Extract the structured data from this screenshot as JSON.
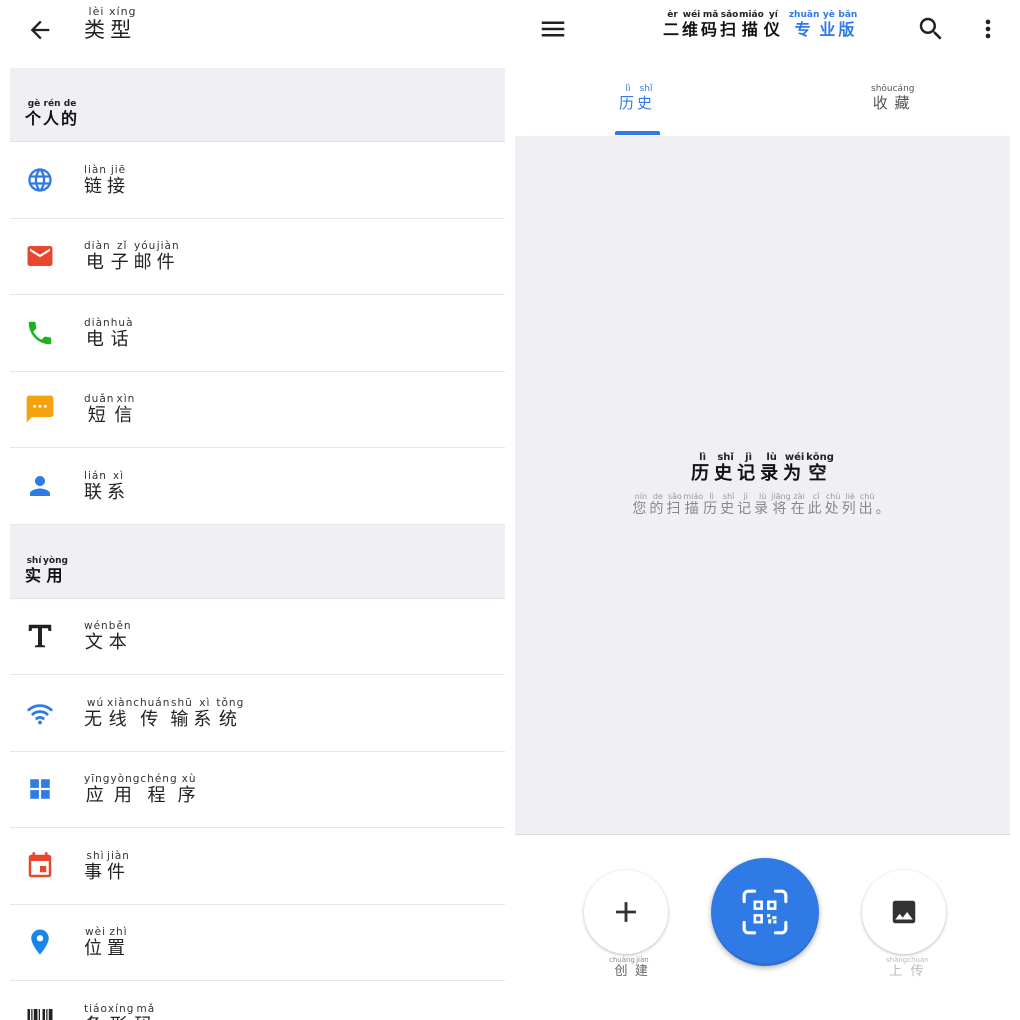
{
  "left": {
    "title": {
      "chars": [
        [
          "类",
          "lèi"
        ],
        [
          "型",
          "xíng"
        ]
      ]
    },
    "sections": [
      {
        "title": [
          [
            "个",
            "gè"
          ],
          [
            "人",
            "rén"
          ],
          [
            "的",
            "de"
          ]
        ],
        "items": [
          {
            "icon": "globe-icon",
            "label": [
              [
                "链",
                "liàn"
              ],
              [
                "接",
                "jiē"
              ]
            ]
          },
          {
            "icon": "email-icon",
            "label": [
              [
                "电",
                "diàn"
              ],
              [
                "子",
                "zǐ"
              ],
              [
                "邮",
                "yóu"
              ],
              [
                "件",
                "jiàn"
              ]
            ]
          },
          {
            "icon": "phone-icon",
            "label": [
              [
                "电",
                "diàn"
              ],
              [
                "话",
                "huà"
              ]
            ]
          },
          {
            "icon": "sms-icon",
            "label": [
              [
                "短",
                "duǎn"
              ],
              [
                "信",
                "xìn"
              ]
            ]
          },
          {
            "icon": "contact-icon",
            "label": [
              [
                "联",
                "lián"
              ],
              [
                "系",
                "xì"
              ]
            ]
          }
        ]
      },
      {
        "title": [
          [
            "实",
            "shí"
          ],
          [
            "用",
            "yòng"
          ]
        ],
        "items": [
          {
            "icon": "text-icon",
            "label": [
              [
                "文",
                "wén"
              ],
              [
                "本",
                "běn"
              ]
            ]
          },
          {
            "icon": "wifi-icon",
            "label": [
              [
                "无",
                "wú"
              ],
              [
                "线",
                "xiàn"
              ],
              [
                "传",
                "chuán"
              ],
              [
                "输",
                "shū"
              ],
              [
                "系",
                "xì"
              ],
              [
                "统",
                "tǒng"
              ]
            ]
          },
          {
            "icon": "apps-icon",
            "label": [
              [
                "应",
                "yīng"
              ],
              [
                "用",
                "yòng"
              ],
              [
                "程",
                "chéng"
              ],
              [
                "序",
                "xù"
              ]
            ]
          },
          {
            "icon": "calendar-icon",
            "label": [
              [
                "事",
                "shì"
              ],
              [
                "件",
                "jiàn"
              ]
            ]
          },
          {
            "icon": "location-icon",
            "label": [
              [
                "位",
                "wèi"
              ],
              [
                "置",
                "zhì"
              ]
            ]
          },
          {
            "icon": "barcode-icon",
            "label": [
              [
                "条",
                "tiáo"
              ],
              [
                "形",
                "xíng"
              ],
              [
                "码",
                "mǎ"
              ]
            ]
          }
        ]
      }
    ]
  },
  "right": {
    "title": [
      [
        "二",
        "èr"
      ],
      [
        "维",
        "wéi"
      ],
      [
        "码",
        "mǎ"
      ],
      [
        "扫",
        "sǎo"
      ],
      [
        "描",
        "miáo"
      ],
      [
        "仪",
        "yí"
      ]
    ],
    "title_pro": [
      [
        "专",
        "zhuān"
      ],
      [
        "业",
        "yè"
      ],
      [
        "版",
        "bǎn"
      ]
    ],
    "tabs": {
      "history": [
        [
          "历",
          "lì"
        ],
        [
          "史",
          "shǐ"
        ]
      ],
      "favorites": [
        [
          "收",
          "shōu"
        ],
        [
          "藏",
          "cáng"
        ]
      ]
    },
    "empty": {
      "title": [
        [
          "历",
          "lì"
        ],
        [
          "史",
          "shǐ"
        ],
        [
          "记",
          "jì"
        ],
        [
          "录",
          "lù"
        ],
        [
          "为",
          "wéi"
        ],
        [
          "空",
          "kōng"
        ]
      ],
      "subtitle": [
        [
          "您",
          "nín"
        ],
        [
          "的",
          "de"
        ],
        [
          "扫",
          "sǎo"
        ],
        [
          "描",
          "miáo"
        ],
        [
          "历",
          "lì"
        ],
        [
          "史",
          "shǐ"
        ],
        [
          "记",
          "jì"
        ],
        [
          "录",
          "lù"
        ],
        [
          "将",
          "jiāng"
        ],
        [
          "在",
          "zài"
        ],
        [
          "此",
          "cǐ"
        ],
        [
          "处",
          "chù"
        ],
        [
          "列",
          "liè"
        ],
        [
          "出",
          "chū"
        ],
        [
          "。",
          ""
        ]
      ]
    },
    "actions": {
      "create": [
        [
          "创",
          "chuàng"
        ],
        [
          "建",
          "jiàn"
        ]
      ],
      "upload": [
        [
          "上",
          "shàng"
        ],
        [
          "传",
          "chuán"
        ]
      ]
    }
  },
  "colors": {
    "accent": "#2f7ae5",
    "email": "#e8462e",
    "phone": "#1bb322",
    "sms": "#f4a20f",
    "calendar": "#e8462e",
    "location": "#1a86e8",
    "section_bg": "#f0f0f4"
  }
}
